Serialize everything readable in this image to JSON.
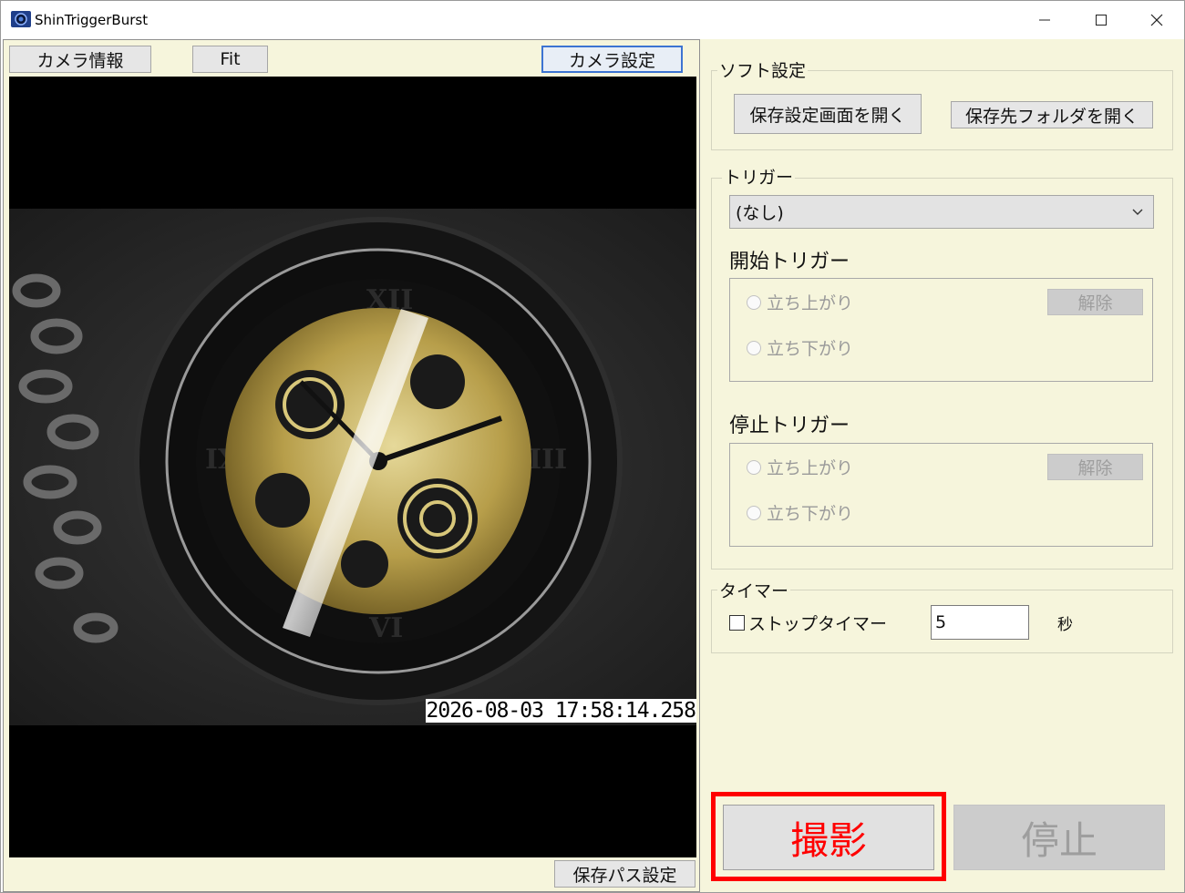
{
  "window": {
    "title": "ShinTriggerBurst",
    "controls": {
      "minimize": "minimize-icon",
      "maximize": "maximize-icon",
      "close": "close-icon"
    }
  },
  "left_panel": {
    "camera_info_label": "カメラ情報",
    "fit_label": "Fit",
    "camera_settings_label": "カメラ設定",
    "timestamp": "2026-08-03 17:58:14.258",
    "save_path_label": "保存パス設定"
  },
  "right_panel": {
    "soft_settings": {
      "title": "ソフト設定",
      "open_save_settings_label": "保存設定画面を開く",
      "open_save_folder_label": "保存先フォルダを開く"
    },
    "trigger": {
      "title": "トリガー",
      "selected": "(なし)",
      "start_trigger": {
        "title": "開始トリガー",
        "rising_label": "立ち上がり",
        "falling_label": "立ち下がり",
        "release_label": "解除"
      },
      "stop_trigger": {
        "title": "停止トリガー",
        "rising_label": "立ち上がり",
        "falling_label": "立ち下がり",
        "release_label": "解除"
      }
    },
    "timer": {
      "title": "タイマー",
      "stop_timer_label": "ストップタイマー",
      "stop_timer_checked": false,
      "value": "5",
      "unit": "秒"
    },
    "capture_label": "撮影",
    "stop_label": "停止"
  },
  "colors": {
    "panel_bg": "#f6f5dc",
    "highlight": "#ff0000",
    "focus_border": "#3d74d2"
  }
}
